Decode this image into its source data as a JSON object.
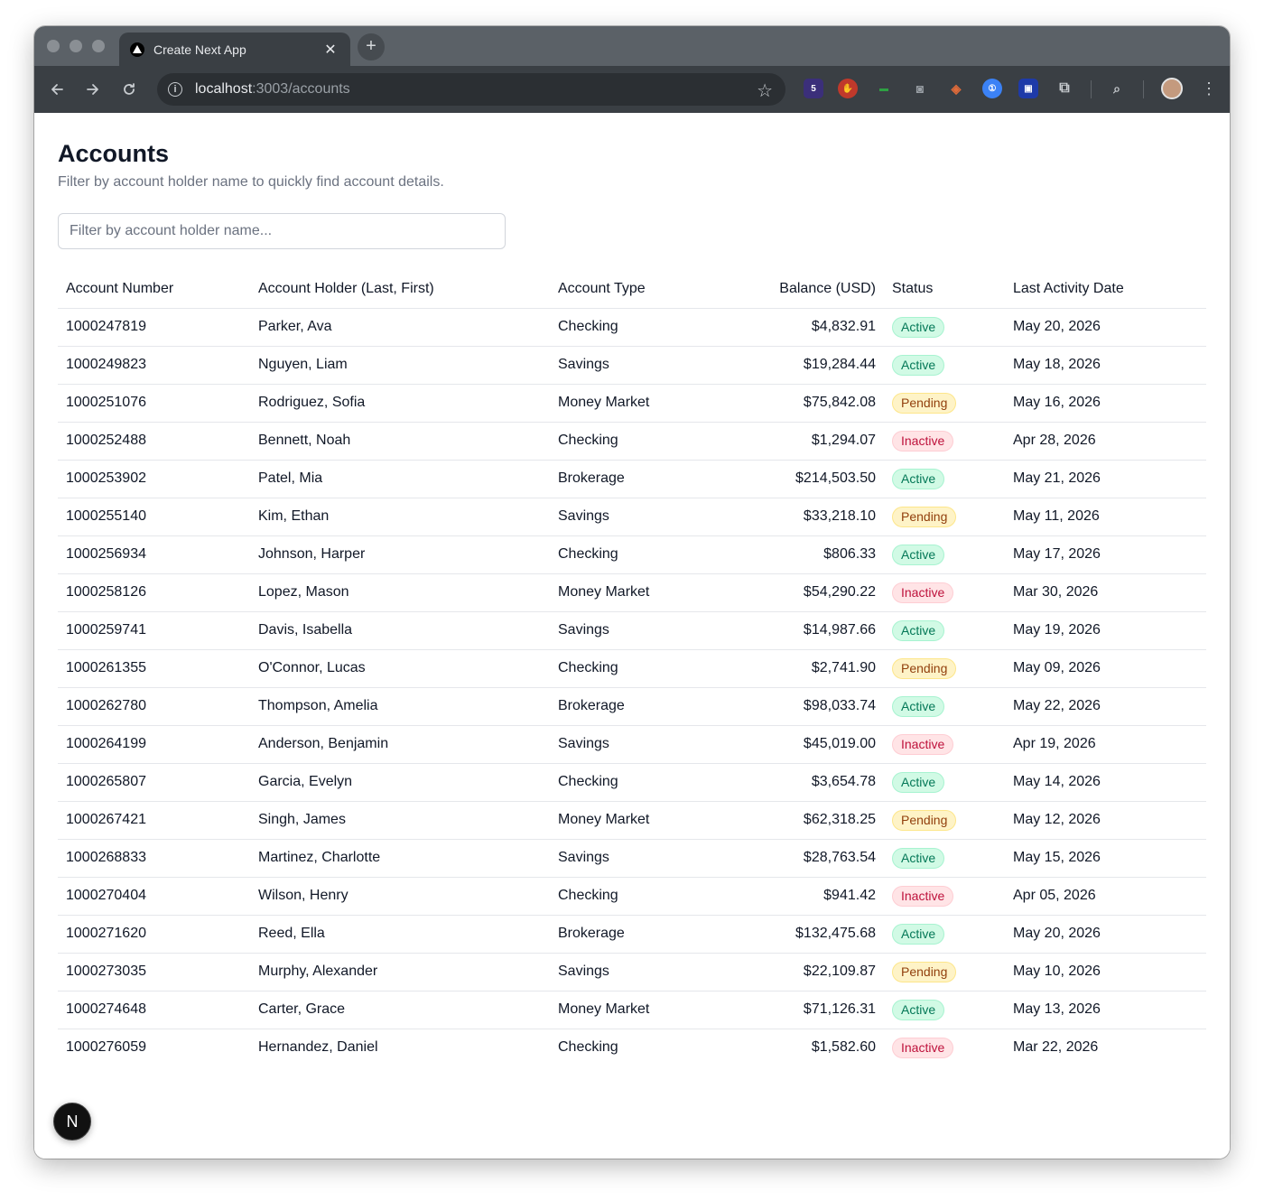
{
  "browser": {
    "tab_title": "Create Next App",
    "url_host": "localhost",
    "url_rest": ":3003/accounts",
    "extension_badge": "5"
  },
  "page": {
    "title": "Accounts",
    "subtitle": "Filter by account holder name to quickly find account details.",
    "filter_placeholder": "Filter by account holder name...",
    "filter_value": ""
  },
  "table": {
    "headers": [
      "Account Number",
      "Account Holder (Last, First)",
      "Account Type",
      "Balance (USD)",
      "Status",
      "Last Activity Date"
    ],
    "rows": [
      {
        "account_number": "1000247819",
        "holder": "Parker, Ava",
        "type": "Checking",
        "balance": "$4,832.91",
        "status": "Active",
        "last_activity": "May 20, 2026"
      },
      {
        "account_number": "1000249823",
        "holder": "Nguyen, Liam",
        "type": "Savings",
        "balance": "$19,284.44",
        "status": "Active",
        "last_activity": "May 18, 2026"
      },
      {
        "account_number": "1000251076",
        "holder": "Rodriguez, Sofia",
        "type": "Money Market",
        "balance": "$75,842.08",
        "status": "Pending",
        "last_activity": "May 16, 2026"
      },
      {
        "account_number": "1000252488",
        "holder": "Bennett, Noah",
        "type": "Checking",
        "balance": "$1,294.07",
        "status": "Inactive",
        "last_activity": "Apr 28, 2026"
      },
      {
        "account_number": "1000253902",
        "holder": "Patel, Mia",
        "type": "Brokerage",
        "balance": "$214,503.50",
        "status": "Active",
        "last_activity": "May 21, 2026"
      },
      {
        "account_number": "1000255140",
        "holder": "Kim, Ethan",
        "type": "Savings",
        "balance": "$33,218.10",
        "status": "Pending",
        "last_activity": "May 11, 2026"
      },
      {
        "account_number": "1000256934",
        "holder": "Johnson, Harper",
        "type": "Checking",
        "balance": "$806.33",
        "status": "Active",
        "last_activity": "May 17, 2026"
      },
      {
        "account_number": "1000258126",
        "holder": "Lopez, Mason",
        "type": "Money Market",
        "balance": "$54,290.22",
        "status": "Inactive",
        "last_activity": "Mar 30, 2026"
      },
      {
        "account_number": "1000259741",
        "holder": "Davis, Isabella",
        "type": "Savings",
        "balance": "$14,987.66",
        "status": "Active",
        "last_activity": "May 19, 2026"
      },
      {
        "account_number": "1000261355",
        "holder": "O'Connor, Lucas",
        "type": "Checking",
        "balance": "$2,741.90",
        "status": "Pending",
        "last_activity": "May 09, 2026"
      },
      {
        "account_number": "1000262780",
        "holder": "Thompson, Amelia",
        "type": "Brokerage",
        "balance": "$98,033.74",
        "status": "Active",
        "last_activity": "May 22, 2026"
      },
      {
        "account_number": "1000264199",
        "holder": "Anderson, Benjamin",
        "type": "Savings",
        "balance": "$45,019.00",
        "status": "Inactive",
        "last_activity": "Apr 19, 2026"
      },
      {
        "account_number": "1000265807",
        "holder": "Garcia, Evelyn",
        "type": "Checking",
        "balance": "$3,654.78",
        "status": "Active",
        "last_activity": "May 14, 2026"
      },
      {
        "account_number": "1000267421",
        "holder": "Singh, James",
        "type": "Money Market",
        "balance": "$62,318.25",
        "status": "Pending",
        "last_activity": "May 12, 2026"
      },
      {
        "account_number": "1000268833",
        "holder": "Martinez, Charlotte",
        "type": "Savings",
        "balance": "$28,763.54",
        "status": "Active",
        "last_activity": "May 15, 2026"
      },
      {
        "account_number": "1000270404",
        "holder": "Wilson, Henry",
        "type": "Checking",
        "balance": "$941.42",
        "status": "Inactive",
        "last_activity": "Apr 05, 2026"
      },
      {
        "account_number": "1000271620",
        "holder": "Reed, Ella",
        "type": "Brokerage",
        "balance": "$132,475.68",
        "status": "Active",
        "last_activity": "May 20, 2026"
      },
      {
        "account_number": "1000273035",
        "holder": "Murphy, Alexander",
        "type": "Savings",
        "balance": "$22,109.87",
        "status": "Pending",
        "last_activity": "May 10, 2026"
      },
      {
        "account_number": "1000274648",
        "holder": "Carter, Grace",
        "type": "Money Market",
        "balance": "$71,126.31",
        "status": "Active",
        "last_activity": "May 13, 2026"
      },
      {
        "account_number": "1000276059",
        "holder": "Hernandez, Daniel",
        "type": "Checking",
        "balance": "$1,582.60",
        "status": "Inactive",
        "last_activity": "Mar 22, 2026"
      }
    ]
  },
  "dev_indicator": "N",
  "icons": {
    "back": "arrow-left-icon",
    "forward": "arrow-right-icon",
    "reload": "reload-icon",
    "site_info": "info-icon",
    "bookmark": "star-icon",
    "extensions": "puzzle-icon",
    "menu": "kebab-icon"
  },
  "colors": {
    "active_bg": "#d1fae5",
    "active_text": "#047857",
    "pending_bg": "#fef3c7",
    "pending_text": "#92400e",
    "inactive_bg": "#ffe4e6",
    "inactive_text": "#be123c"
  }
}
